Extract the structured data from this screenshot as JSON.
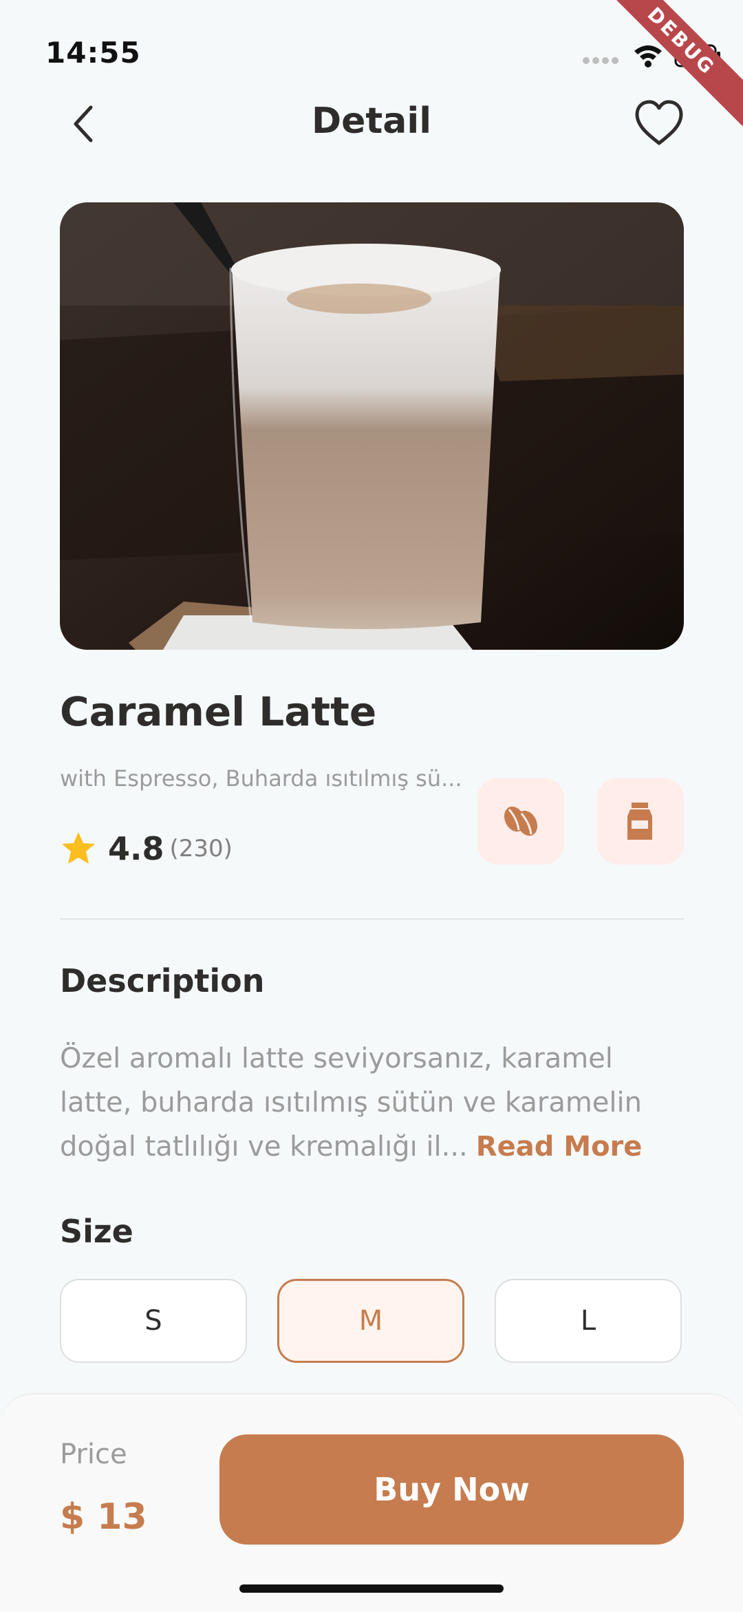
{
  "status_bar": {
    "time": "14:55"
  },
  "debug_banner": "DEBUG",
  "header": {
    "title": "Detail"
  },
  "product": {
    "name": "Caramel Latte",
    "subtitle": "with Espresso, Buharda ısıtılmış sü...",
    "rating": "4.8",
    "rating_count": "(230)"
  },
  "features": [
    {
      "icon": "coffee-bean-icon"
    },
    {
      "icon": "milk-carton-icon"
    }
  ],
  "description": {
    "heading": "Description",
    "text": "Özel aromalı latte seviyorsanız, karamel latte, buharda ısıtılmış sütün ve karamelin doğal tatlılığı ve kremalığı il...",
    "read_more": "Read More"
  },
  "size": {
    "heading": "Size",
    "options": [
      "S",
      "M",
      "L"
    ],
    "selected": "M"
  },
  "footer": {
    "price_label": "Price",
    "price_value": "$ 13",
    "buy_label": "Buy Now"
  },
  "colors": {
    "accent": "#C67C4E",
    "chip_background": "#FFEDEA",
    "background": "#F5F9F9",
    "star": "#FBBE21"
  }
}
